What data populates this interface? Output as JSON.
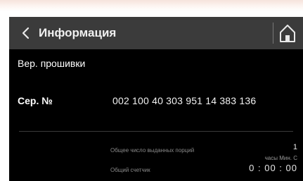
{
  "header": {
    "title": "Информация",
    "back_icon": "chevron-left-icon",
    "home_icon": "home-icon"
  },
  "info": {
    "firmware_label": "Вер. прошивки",
    "serial_label": "Сер. №",
    "serial_value": "002 100 40 303 951 14 383 136"
  },
  "stats": {
    "issued_caption": "Общее число выданных порций",
    "issued_value": "1",
    "counter_caption": "Общий счетчик",
    "counter_units": "часы  Мин.  С",
    "counter_value": "0 : 00 : 00"
  },
  "colors": {
    "header_bg": "#3b3b3b",
    "screen_bg": "#000000",
    "text": "#ffffff"
  }
}
